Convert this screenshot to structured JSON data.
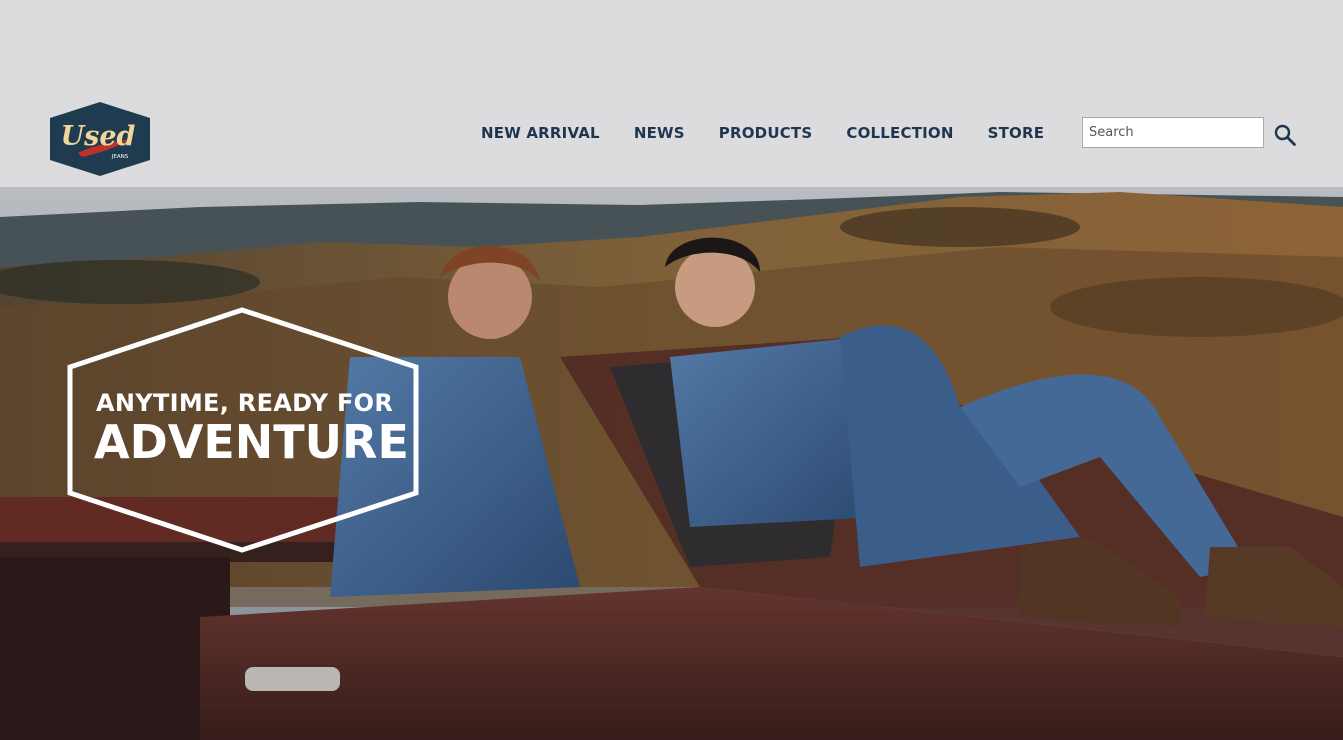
{
  "header": {
    "logo_text": "Used",
    "logo_subtext": "JEANS",
    "nav": [
      {
        "label": "NEW ARRIVAL"
      },
      {
        "label": "NEWS"
      },
      {
        "label": "PRODUCTS"
      },
      {
        "label": "COLLECTION"
      },
      {
        "label": "STORE"
      }
    ],
    "search": {
      "placeholder": "Search",
      "value": ""
    }
  },
  "hero": {
    "tagline_line1": "ANYTIME, READY FOR",
    "tagline_line2": "ADVENTURE"
  },
  "colors": {
    "header_bg": "#dcdcde",
    "nav_text": "#1f3650",
    "logo_bg": "#1e3b50",
    "logo_text": "#f1d59a",
    "logo_swoosh": "#c0302e"
  },
  "icons": {
    "search": "search-icon"
  }
}
